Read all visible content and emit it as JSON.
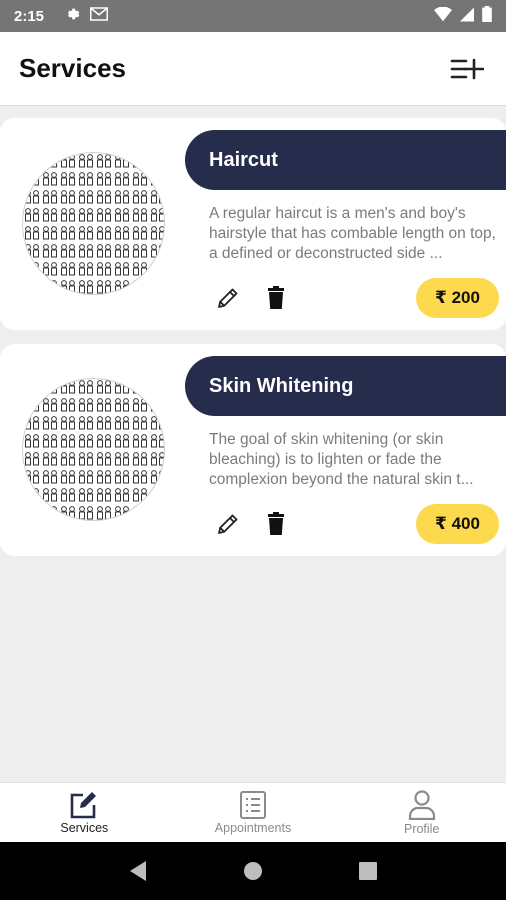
{
  "status_bar": {
    "time": "2:15",
    "icons": [
      "gear-icon",
      "mail-icon",
      "wifi-icon",
      "signal-icon",
      "battery-icon"
    ]
  },
  "app_bar": {
    "title": "Services",
    "add_icon": "list-add-icon"
  },
  "services": [
    {
      "title": "Haircut",
      "description": "A regular haircut is a men's and boy's hairstyle that has combable length on top, a defined or deconstructed side ...",
      "price": "₹ 200",
      "image_icon": "people-pattern-image"
    },
    {
      "title": "Skin Whitening",
      "description": "The goal of skin whitening (or skin bleaching) is to lighten or fade the complexion beyond the natural skin t...",
      "price": "₹ 400",
      "image_icon": "people-pattern-image"
    }
  ],
  "bottom_nav": {
    "items": [
      {
        "label": "Services",
        "icon": "edit-square-icon",
        "active": true
      },
      {
        "label": "Appointments",
        "icon": "list-icon",
        "active": false
      },
      {
        "label": "Profile",
        "icon": "person-icon",
        "active": false
      }
    ]
  },
  "colors": {
    "header_navy": "#262c4c",
    "price_yellow": "#fdd94e",
    "background": "#eeeeee",
    "status_bar": "#757575"
  }
}
